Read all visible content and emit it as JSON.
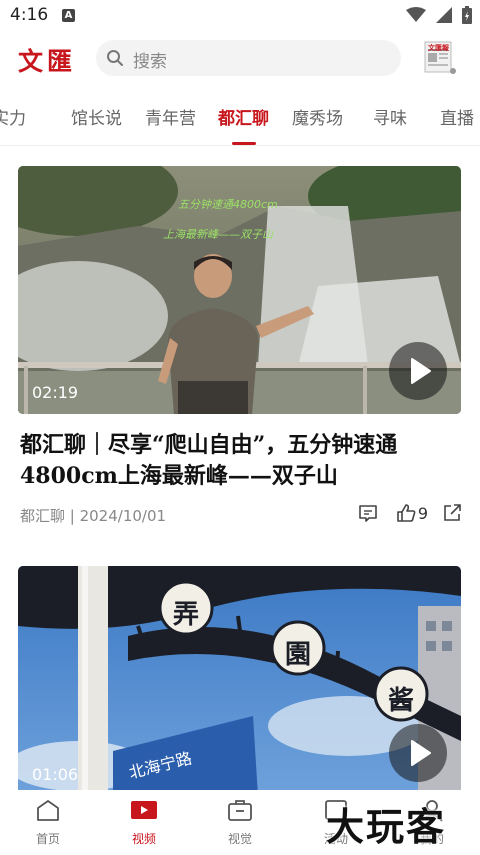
{
  "status_bar": {
    "time": "4:16",
    "notification_letter": "A"
  },
  "header": {
    "logo": "文匯",
    "search_placeholder": "搜索",
    "newspaper_label": "文匯報"
  },
  "tabs": [
    "实力",
    "馆长说",
    "青年营",
    "都汇聊",
    "魔秀场",
    "寻味",
    "直播"
  ],
  "active_tab": "都汇聊",
  "cards": [
    {
      "duration": "02:19",
      "overlay_line1": "五分钟速通4800cm",
      "overlay_line2": "上海最新峰——双子山",
      "title": "都汇聊｜尽享“爬山自由”，五分钟速通4800cm上海最新峰——双子山",
      "meta": "都汇聊 | 2024/10/01",
      "likes": "9"
    },
    {
      "duration": "01:06",
      "sign_chars": [
        "弄",
        "園",
        "酱"
      ],
      "street_sign": "北海宁路"
    }
  ],
  "bottom_nav": [
    {
      "label": "首页",
      "icon": "home-icon"
    },
    {
      "label": "视频",
      "icon": "video-icon"
    },
    {
      "label": "视觉",
      "icon": "briefcase-icon"
    },
    {
      "label": "活动",
      "icon": "activity-icon"
    },
    {
      "label": "我的",
      "icon": "profile-icon"
    }
  ],
  "active_nav": "视频",
  "watermark": "大玩客",
  "colors": {
    "accent": "#c8161d",
    "text": "#111111",
    "muted": "#888888"
  }
}
